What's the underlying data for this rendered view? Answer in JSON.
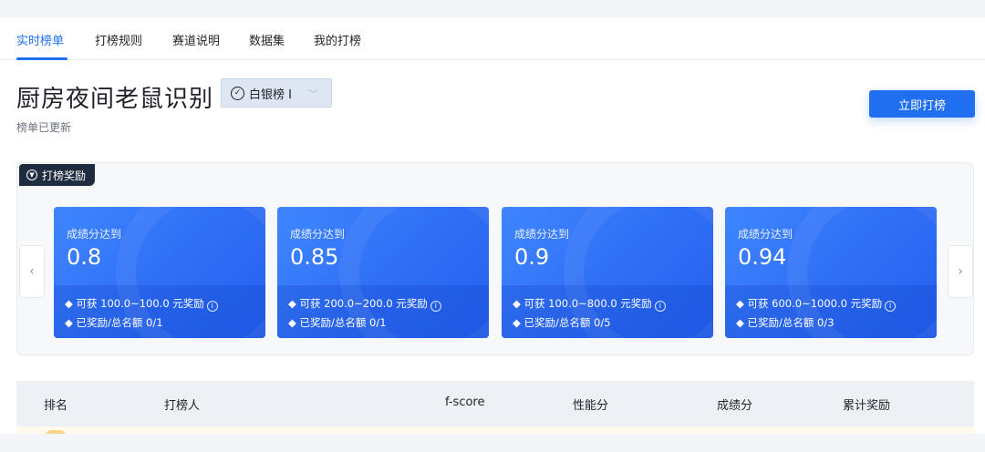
{
  "tabs": [
    {
      "label": "实时榜单",
      "active": true
    },
    {
      "label": "打榜规则"
    },
    {
      "label": "赛道说明"
    },
    {
      "label": "数据集"
    },
    {
      "label": "我的打榜"
    }
  ],
  "header": {
    "title": "厨房夜间老鼠识别",
    "badge_label": "白银榜 I",
    "subtitle": "榜单已更新",
    "submit_button": "立即打榜"
  },
  "rewards": {
    "tag_label": "打榜奖励",
    "cards": [
      {
        "label": "成绩分达到",
        "value": "0.8",
        "reward": "◆ 可获 100.0~100.0 元奖励",
        "quota": "◆ 已奖励/总名额 0/1"
      },
      {
        "label": "成绩分达到",
        "value": "0.85",
        "reward": "◆ 可获 200.0~200.0 元奖励",
        "quota": "◆ 已奖励/总名额 0/1"
      },
      {
        "label": "成绩分达到",
        "value": "0.9",
        "reward": "◆ 可获 100.0~800.0 元奖励",
        "quota": "◆ 已奖励/总名额 0/5"
      },
      {
        "label": "成绩分达到",
        "value": "0.94",
        "reward": "◆ 可获 600.0~1000.0 元奖励",
        "quota": "◆ 已奖励/总名额 0/3"
      }
    ]
  },
  "table": {
    "columns": [
      "排名",
      "打榜人",
      "f-score",
      "性能分",
      "成绩分",
      "累计奖励"
    ]
  },
  "colors": {
    "accent": "#1f6ff0",
    "card_blue": "#2f6ef5",
    "tag_dark": "#1f2c3f"
  },
  "icons": {
    "badge": "check-circle-icon",
    "tag": "download-circle-icon",
    "prev": "chevron-left-icon",
    "next": "chevron-right-icon",
    "info": "info-icon"
  }
}
